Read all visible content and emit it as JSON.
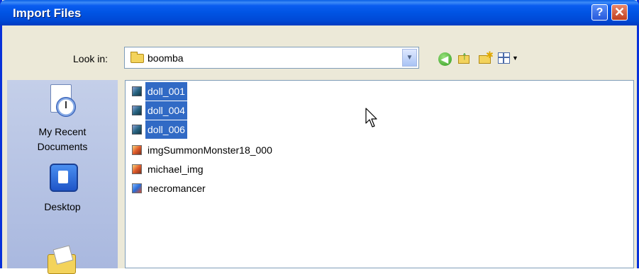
{
  "window": {
    "title": "Import Files",
    "help_label": "?",
    "close_label": "✕"
  },
  "lookin": {
    "label": "Look in:",
    "value": "boomba",
    "dropdown_icon": "chevron-down-icon"
  },
  "toolbar": {
    "back_icon": "back-icon",
    "up_icon": "up-folder-icon",
    "new_folder_icon": "new-folder-icon",
    "views_icon": "views-menu-icon"
  },
  "places": [
    {
      "label": "My Recent\nDocuments",
      "icon": "recent-documents-icon"
    },
    {
      "label": "Desktop",
      "icon": "desktop-icon"
    },
    {
      "label": "",
      "icon": "my-documents-icon"
    }
  ],
  "files": [
    {
      "name": "doll_001",
      "selected": true
    },
    {
      "name": "doll_004",
      "selected": true
    },
    {
      "name": "doll_006",
      "selected": true
    },
    {
      "name": "imgSummonMonster18_000",
      "selected": false
    },
    {
      "name": "michael_img",
      "selected": false
    },
    {
      "name": "necromancer",
      "selected": false
    }
  ],
  "colors": {
    "titlebar": "#0054e3",
    "selection": "#316ac5",
    "dialog_bg": "#ece9d8"
  }
}
